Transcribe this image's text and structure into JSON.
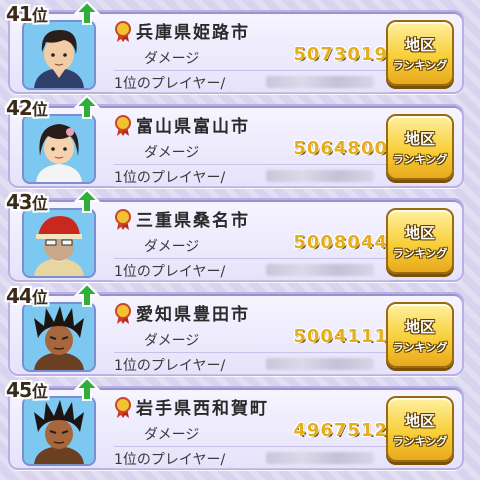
{
  "colors": {
    "background": "#d8d4ef",
    "damage_value": "#e5ae1a",
    "button": "#f8cf3a",
    "rank_up_arrow": "#2fae3a"
  },
  "rows": [
    {
      "rank_num": "41",
      "rank_suffix": "位",
      "trend": "up",
      "area": "兵庫県姫路市",
      "damage_label": "ダメージ",
      "damage": "5073019",
      "player_label": "1位のプレイヤー/",
      "button_line1": "地区",
      "button_line2": "ランキング",
      "avatar": "boy-dark-hair-icon"
    },
    {
      "rank_num": "42",
      "rank_suffix": "位",
      "trend": "up",
      "area": "富山県富山市",
      "damage_label": "ダメージ",
      "damage": "5064800",
      "player_label": "1位のプレイヤー/",
      "button_line1": "地区",
      "button_line2": "ランキング",
      "avatar": "girl-bob-hair-icon"
    },
    {
      "rank_num": "43",
      "rank_suffix": "位",
      "trend": "up",
      "area": "三重県桑名市",
      "damage_label": "ダメージ",
      "damage": "5008044",
      "player_label": "1位のプレイヤー/",
      "button_line1": "地区",
      "button_line2": "ランキング",
      "avatar": "old-man-red-cap-icon"
    },
    {
      "rank_num": "44",
      "rank_suffix": "位",
      "trend": "up",
      "area": "愛知県豊田市",
      "damage_label": "ダメージ",
      "damage": "5004111",
      "player_label": "1位のプレイヤー/",
      "button_line1": "地区",
      "button_line2": "ランキング",
      "avatar": "spiky-hair-boy-icon"
    },
    {
      "rank_num": "45",
      "rank_suffix": "位",
      "trend": "up",
      "area": "岩手県西和賀町",
      "damage_label": "ダメージ",
      "damage": "4967512",
      "player_label": "1位のプレイヤー/",
      "button_line1": "地区",
      "button_line2": "ランキング",
      "avatar": "spiky-hair-boy-icon"
    }
  ]
}
